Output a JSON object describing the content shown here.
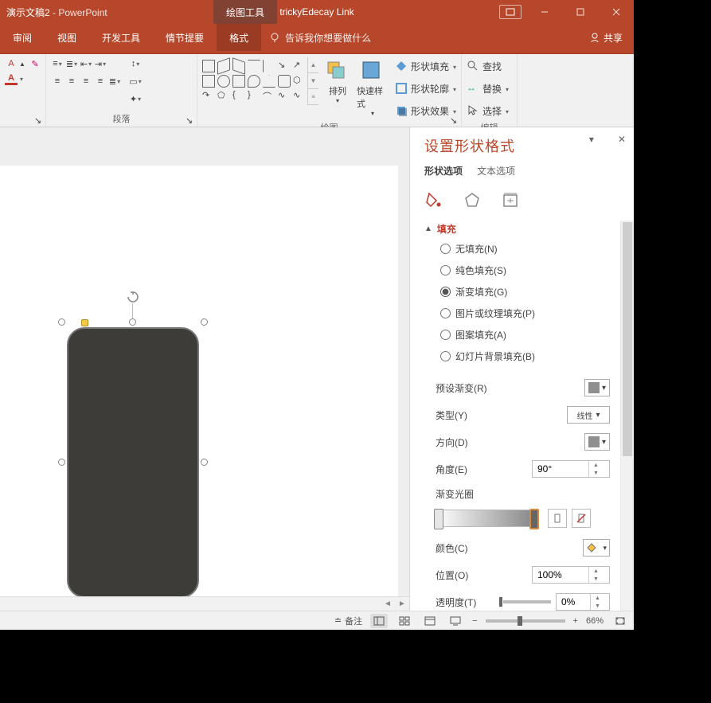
{
  "title": {
    "doc": "演示文稿2",
    "sep": " - ",
    "app": "PowerPoint",
    "context": "绘图工具",
    "center": "trickyEdecay Link"
  },
  "menu": {
    "review": "审阅",
    "view": "视图",
    "devtools": "开发工具",
    "story": "情节提要",
    "format": "格式",
    "tellme": "告诉我你想要做什么",
    "share": "共享"
  },
  "ribbon": {
    "paragraph": "段落",
    "drawing": "绘图",
    "editing": "编辑",
    "arrange": "排列",
    "quickstyles": "快速样式",
    "shapefill": "形状填充",
    "shapeoutline": "形状轮廓",
    "shapeeffects": "形状效果",
    "find": "查找",
    "replace": "替换",
    "select": "选择"
  },
  "pane": {
    "title": "设置形状格式",
    "tab_shape": "形状选项",
    "tab_text": "文本选项",
    "section_fill": "填充",
    "fill_none": "无填充(N)",
    "fill_solid": "纯色填充(S)",
    "fill_gradient": "渐变填充(G)",
    "fill_picture": "图片或纹理填充(P)",
    "fill_pattern": "图案填充(A)",
    "fill_slidebg": "幻灯片背景填充(B)",
    "preset": "预设渐变(R)",
    "type": "类型(Y)",
    "type_linear": "线性",
    "direction": "方向(D)",
    "angle": "角度(E)",
    "angle_val": "90°",
    "stops": "渐变光圈",
    "color": "颜色(C)",
    "position": "位置(O)",
    "position_val": "100%",
    "transparency": "透明度(T)",
    "transparency_val": "0%"
  },
  "status": {
    "notes": "备注",
    "zoom": "66%"
  }
}
